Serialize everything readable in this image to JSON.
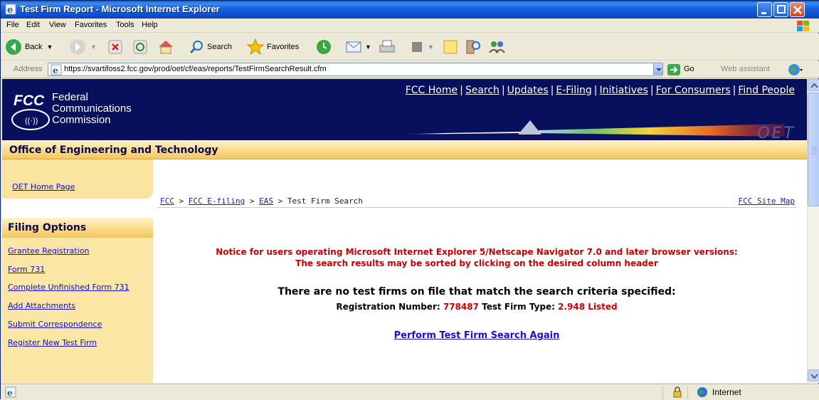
{
  "window": {
    "title": "Test Firm Report - Microsoft Internet Explorer"
  },
  "menu": [
    "File",
    "Edit",
    "View",
    "Favorites",
    "Tools",
    "Help"
  ],
  "toolbar": {
    "back": "Back",
    "search": "Search",
    "favorites": "Favorites"
  },
  "address": {
    "label": "Address",
    "url": "https://svartifoss2.fcc.gov/prod/oet/cf/eas/reports/TestFirmSearchResult.cfm",
    "go": "Go",
    "web_assistant": "Web assistant"
  },
  "fcc": {
    "logo_letters": "FCC",
    "logo_line1": "Federal",
    "logo_line2": "Communications",
    "logo_line3": "Commission",
    "nav": [
      "FCC Home",
      "Search",
      "Updates",
      "E-Filing",
      "Initiatives",
      "For Consumers",
      "Find People"
    ],
    "oet_mark": "OET",
    "section_title": "Office of Engineering and Technology"
  },
  "sidebar": {
    "oet_home": "OET Home Page",
    "filing_options": "Filing Options",
    "items": [
      "Grantee Registration",
      "Form 731",
      "Complete Unfinished Form 731",
      "Add Attachments",
      "Submit Correspondence",
      "Register New Test Firm"
    ]
  },
  "breadcrumb": {
    "fcc": "FCC",
    "efiling": "FCC E-filing",
    "eas": "EAS",
    "current": "Test Firm Search",
    "site_map": "FCC Site Map",
    "sep": " > "
  },
  "main": {
    "notice_line1": "Notice for users operating Microsoft Internet Explorer 5/Netscape Navigator 7.0 and later browser versions:",
    "notice_line2": "The search results may be sorted by clicking on the desired column header",
    "no_firms": "There are no test firms on file that match the search criteria specified:",
    "reg_label": "Registration Number:",
    "reg_number": "778487",
    "type_label": "Test Firm Type:",
    "type_value": "2.948 Listed",
    "search_again": "Perform Test Firm Search Again"
  },
  "status": {
    "zone": "Internet"
  },
  "colors": {
    "fcc_blue": "#08105e",
    "notice_red": "#cc0000",
    "link_blue": "#0f0ecc",
    "banner_gold": "#f6c75c"
  }
}
